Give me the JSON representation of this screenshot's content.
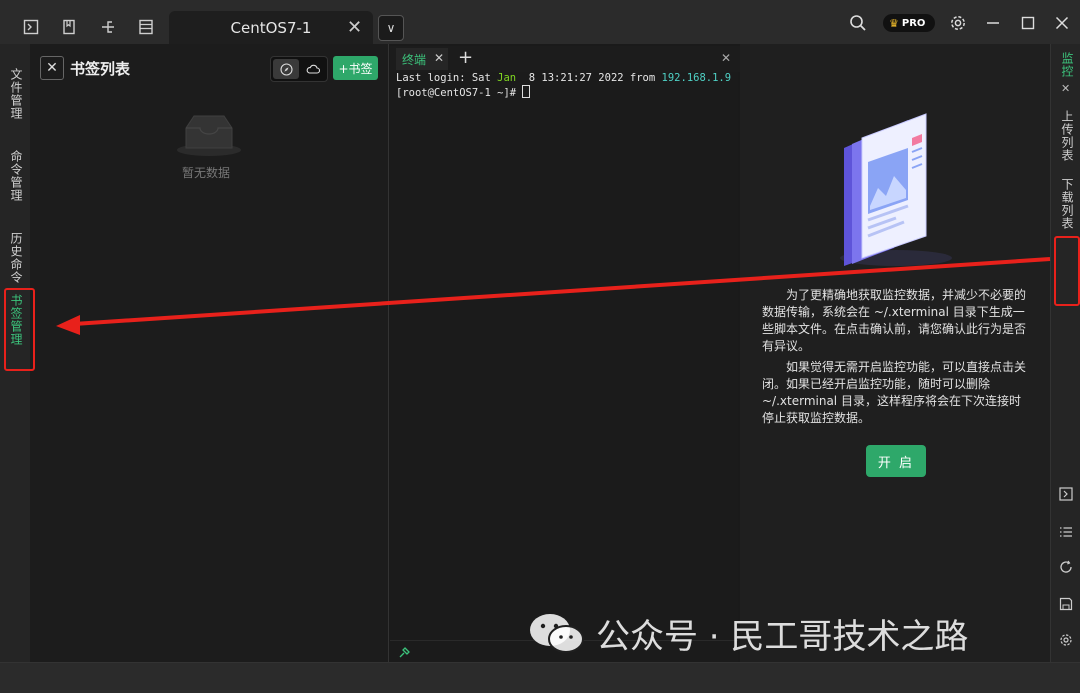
{
  "titlebar": {
    "tab_title": "CentOS7-1",
    "tab_close": "✕",
    "dropdown_glyph": "∨",
    "pro_label": "PRO"
  },
  "left_sidebar": {
    "items": [
      {
        "label": "文件管理",
        "active": false
      },
      {
        "label": "命令管理",
        "active": false
      },
      {
        "label": "历史命令",
        "active": false
      },
      {
        "label": "书签管理",
        "active": true
      }
    ]
  },
  "bookmarks": {
    "title": "书签列表",
    "add_button": "+书签",
    "empty_text": "暂无数据"
  },
  "terminal": {
    "tab_label": "终端",
    "new_tab": "+",
    "close_glyph": "✕",
    "line1": {
      "a": "Last login: Sat ",
      "month": "Jan",
      "b": "  8 13:21:27 2022 from ",
      "ip": "192.168.1.9"
    },
    "prompt": "[root@CentOS7-1 ~]# "
  },
  "monitor": {
    "para1": "为了更精确地获取监控数据，并减少不必要的数据传输，系统会在 ~/.xterminal 目录下生成一些脚本文件。在点击确认前，请您确认此行为是否有异议。",
    "para2": "如果觉得无需开启监控功能，可以直接点击关闭。如果已经开启监控功能，随时可以删除 ~/.xterminal 目录，这样程序将会在下次连接时停止获取监控数据。",
    "button": "开 启"
  },
  "right_sidebar": {
    "items": [
      {
        "label": "监控",
        "active": true
      },
      {
        "label": "上传列表",
        "active": false
      },
      {
        "label": "下载列表",
        "active": false
      }
    ],
    "close_glyph": "✕"
  },
  "watermark": {
    "text": "公众号 · 民工哥技术之路"
  },
  "colors": {
    "accent_green": "#2ea86a",
    "active_text": "#3cc47c",
    "annotation_red": "#e8211b",
    "term_green": "#7ed321",
    "term_cyan": "#4fd1c5"
  }
}
